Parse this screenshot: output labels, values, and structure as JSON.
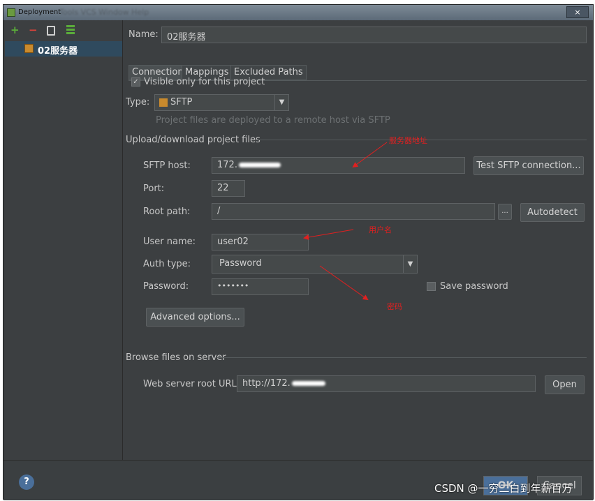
{
  "window": {
    "title": "Deployment",
    "ghost_menu": "Tools  VCS  Window  Help",
    "close": "×"
  },
  "toolbar": {
    "add": "+",
    "remove": "−"
  },
  "servers": [
    {
      "label": "02服务器"
    }
  ],
  "form": {
    "name_label": "Name:",
    "name_value": "02服务器",
    "tabs": [
      {
        "label": "Connection"
      },
      {
        "label": "Mappings"
      },
      {
        "label": "Excluded Paths"
      }
    ],
    "visible_only_label": "Visible only for this project",
    "type_label": "Type:",
    "type_value": "SFTP",
    "type_hint": "Project files are deployed to a remote host via SFTP",
    "upload_section": "Upload/download project files",
    "sftp_host_label": "SFTP host:",
    "sftp_host_value": "172.",
    "test_button": "Test SFTP connection...",
    "port_label": "Port:",
    "port_value": "22",
    "root_path_label": "Root path:",
    "root_path_value": "/",
    "browse_button": "...",
    "autodetect_button": "Autodetect",
    "user_name_label": "User name:",
    "user_name_value": "user02",
    "auth_type_label": "Auth type:",
    "auth_type_value": "Password",
    "password_label": "Password:",
    "password_value": "•••••••",
    "save_password_label": "Save password",
    "advanced_button": "Advanced options...",
    "browse_section": "Browse files on server",
    "web_root_label": "Web server root URL:",
    "web_root_value": "http://172.",
    "open_button": "Open"
  },
  "annotations": {
    "server_address": "服务器地址",
    "username": "用户名",
    "password": "密码"
  },
  "footer": {
    "help": "?",
    "ok": "OK",
    "cancel": "Cancel"
  },
  "watermark": "CSDN @一穷二白到年薪百万",
  "colors": {
    "annotation": "#e02020",
    "selection": "#2f4a5e",
    "background": "#3c3f41"
  }
}
